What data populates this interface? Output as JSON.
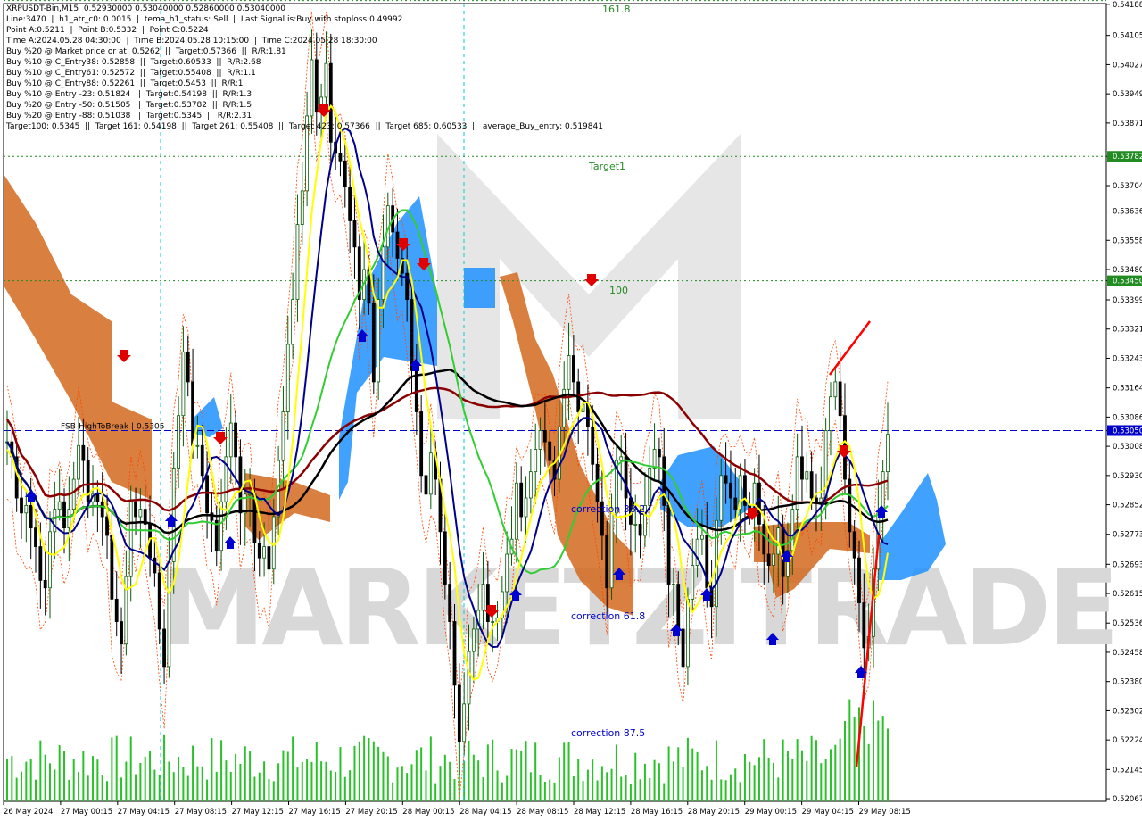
{
  "colors": {
    "background": "#ffffff",
    "axis": "#000000",
    "bull_candle": "#0a5c0a",
    "bear_candle": "#000000",
    "volume": "#29c229",
    "dark_red_ma": "#8b0000",
    "black_ma": "#000000",
    "navy_ma": "#00008b",
    "green_ma": "#32cd32",
    "yellow_ma": "#ffff00",
    "cloud_blue": "#1e90ff",
    "cloud_orange": "#d2691e",
    "level_green": "#228b22",
    "level_blue": "#0000cd",
    "trend_red": "#ff0000",
    "watermark": "#d8d8d8",
    "fractal_dots": "#ff4500"
  },
  "info_lines": [
    "XRPUSDT-Bin,M15  0.52930000 0.53040000 0.52860000 0.53040000",
    "Line:3470  |  h1_atr_c0: 0.0015  |  tema_h1_status: Sell  |  Last Signal is:Buy with stoploss:0.49992",
    "Point A:0.5211  |  Point B:0.5332  |  Point C:0.5224",
    "Time A:2024.05.28 04:30:00  |  Time B:2024.05.28 10:15:00  |  Time C:2024.05.28 18:30:00",
    "Buy %20 @ Market price or at: 0.5262  ||  Target:0.57366  ||  R/R:1.81",
    "Buy %10 @ C_Entry38: 0.52858  ||  Target:0.60533  ||  R/R:2.68",
    "Buy %10 @ C_Entry61: 0.52572  ||  Target:0.55408  ||  R/R:1.1",
    "Buy %10 @ C_Entry88: 0.52261  ||  Target:0.5453  ||  R/R:1",
    "Buy %10 @ Entry -23: 0.51824  ||  Target:0.54198  ||  R/R:1.3",
    "Buy %20 @ Entry -50: 0.51505  ||  Target:0.53782  ||  R/R:1.5",
    "Buy %20 @ Entry -88: 0.51038  ||  Target:0.5345  ||  R/R:2.31",
    "Target100: 0.5345  ||  Target 161: 0.54198  ||  Target 261: 0.55408  ||  Target 423: 0.57366  ||  Target 685: 0.60533  ||  average_Buy_entry: 0.519841"
  ],
  "watermark_text": "MARKETZITRADE",
  "chart_data": {
    "type": "line",
    "symbol": "XRPUSDT-Bin",
    "timeframe": "M15",
    "ylim": [
      0.5206,
      0.5419
    ],
    "y_ticks": [
      "0.54188",
      "0.54105",
      "0.54027",
      "0.53949",
      "0.53871",
      "0.53782",
      "0.53704",
      "0.53636",
      "0.53558",
      "0.53480",
      "0.53450",
      "0.53399",
      "0.53321",
      "0.53243",
      "0.53164",
      "0.53086",
      "0.53050",
      "0.53008",
      "0.52930",
      "0.52852",
      "0.52773",
      "0.52693",
      "0.52615",
      "0.52536",
      "0.52458",
      "0.52380",
      "0.52302",
      "0.52224",
      "0.52145",
      "0.52067"
    ],
    "x_ticks": [
      "26 May 2024",
      "27 May 00:15",
      "27 May 04:15",
      "27 May 08:15",
      "27 May 12:15",
      "27 May 16:15",
      "27 May 20:15",
      "28 May 00:15",
      "28 May 04:15",
      "28 May 08:15",
      "28 May 12:15",
      "28 May 16:15",
      "28 May 20:15",
      "29 May 00:15",
      "29 May 04:15",
      "29 May 08:15"
    ],
    "levels": [
      {
        "label": "161.8",
        "value": 0.54198,
        "style": "green-dotted"
      },
      {
        "label": "Target1",
        "value": 0.53782,
        "style": "green-dotted"
      },
      {
        "label": "100",
        "value": 0.5345,
        "style": "green-dotted"
      },
      {
        "label": "FSB-HighToBreak | 0.5305",
        "value": 0.5305,
        "style": "blue-dashed"
      }
    ],
    "annotations": [
      {
        "label": "correction 38.2",
        "value": 0.52858
      },
      {
        "label": "correction 61.8",
        "value": 0.52572
      },
      {
        "label": "correction 87.5",
        "value": 0.52261
      }
    ],
    "price_badges": [
      "0.53782",
      "0.53450",
      "0.53050"
    ],
    "series": [
      {
        "values": [
          0.5302,
          0.5298,
          0.5287,
          0.5283,
          0.5285,
          0.5279,
          0.5274,
          0.5265,
          0.5263,
          0.5278,
          0.5284,
          0.5286,
          0.5279,
          0.5284,
          0.5292,
          0.5301,
          0.5297,
          0.5286,
          0.5288,
          0.5286,
          0.5282,
          0.5277,
          0.526,
          0.5254,
          0.5248,
          0.5266,
          0.5286,
          0.5282,
          0.5284,
          0.528,
          0.5271,
          0.5267,
          0.5252,
          0.5242,
          0.527,
          0.5295,
          0.5309,
          0.5326,
          0.5318,
          0.5301,
          0.5301,
          0.5293,
          0.5283,
          0.5281,
          0.5273,
          0.5286,
          0.5298,
          0.5307,
          0.5298,
          0.5283,
          0.5288,
          0.5288,
          0.5275,
          0.5271,
          0.5274,
          0.5268,
          0.5282,
          0.5297,
          0.531,
          0.5328,
          0.534,
          0.536,
          0.5369,
          0.5389,
          0.5404,
          0.539,
          0.5394,
          0.5403,
          0.5382,
          0.5379,
          0.5377,
          0.537,
          0.5361,
          0.5354,
          0.534,
          0.5348,
          0.5339,
          0.5318,
          0.534,
          0.5354,
          0.5365,
          0.5358,
          0.5351,
          0.5347,
          0.534,
          0.5321,
          0.531,
          0.5293,
          0.5288,
          0.5299,
          0.5292,
          0.5278,
          0.5264,
          0.5254,
          0.5237,
          0.5222,
          0.5232,
          0.5246,
          0.5252,
          0.5257,
          0.5264,
          0.5254,
          0.5254,
          0.5255,
          0.5262,
          0.5272,
          0.5276,
          0.5291,
          0.5282,
          0.5287,
          0.5294,
          0.53,
          0.5305,
          0.5302,
          0.5297,
          0.5292,
          0.5306,
          0.5316,
          0.5325,
          0.5318,
          0.531,
          0.5312,
          0.5306,
          0.5296,
          0.5286,
          0.5277,
          0.5263,
          0.5283,
          0.5297,
          0.5298,
          0.5287,
          0.528,
          0.528,
          0.5277,
          0.5285,
          0.5295,
          0.53,
          0.5298,
          0.5285,
          0.5264,
          0.5264,
          0.5252,
          0.5242,
          0.526,
          0.5269,
          0.5276,
          0.5277,
          0.5263,
          0.5258,
          0.5281,
          0.5293,
          0.5291,
          0.5287,
          0.5284,
          0.5293,
          0.5285,
          0.5283,
          0.5291,
          0.528,
          0.5272,
          0.5269,
          0.5272,
          0.5279,
          0.5266,
          0.5273,
          0.5284,
          0.5298,
          0.5292,
          0.5294,
          0.5287,
          0.5286,
          0.5287,
          0.5305,
          0.5314,
          0.5318,
          0.5309,
          0.5292,
          0.5278,
          0.5271,
          0.5259,
          0.5247,
          0.525,
          0.5268,
          0.5283,
          0.5294,
          0.5304
        ]
      },
      {
        "name": "tick_y_gap",
        "values": []
      }
    ]
  }
}
